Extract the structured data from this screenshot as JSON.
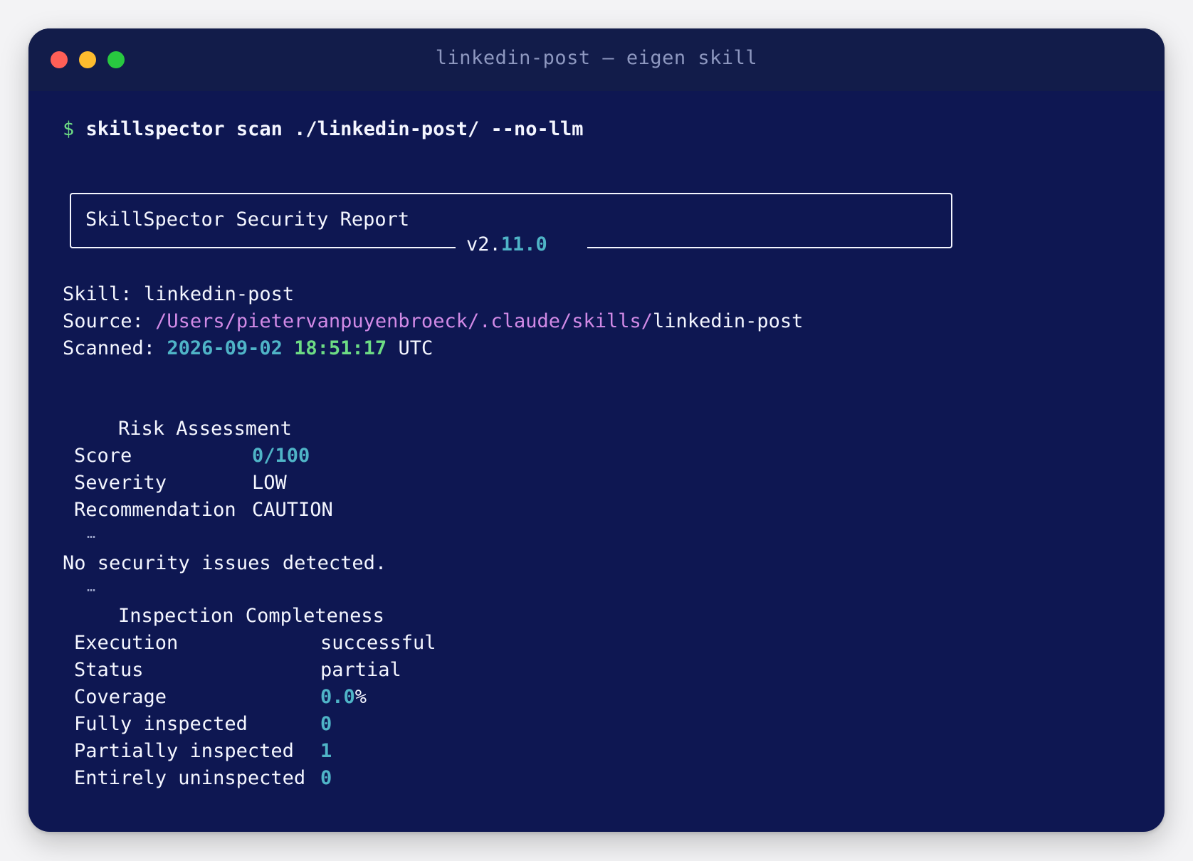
{
  "window": {
    "title": "linkedin-post — eigen skill"
  },
  "prompt": {
    "symbol": "$",
    "command": "skillspector scan ./linkedin-post/ --no-llm"
  },
  "report_box": {
    "title": "SkillSpector Security Report",
    "version_prefix": "v2.",
    "version_suffix": "11.0"
  },
  "meta": {
    "skill_label": "Skill:",
    "skill_value": "linkedin-post",
    "source_label": "Source:",
    "source_path_dim": "/Users/pietervanpuyenbroeck/.claude/skills/",
    "source_path_name": "linkedin-post",
    "scanned_label": "Scanned:",
    "scanned_date": "2026-09-02",
    "scanned_time": "18:51:17",
    "scanned_tz": "UTC"
  },
  "risk": {
    "heading": "Risk Assessment",
    "rows": [
      {
        "label": "Score",
        "value": "0/100"
      },
      {
        "label": "Severity",
        "value": "LOW"
      },
      {
        "label": "Recommendation",
        "value": "CAUTION"
      }
    ]
  },
  "separator": "…",
  "issues_message": "No security issues detected.",
  "completeness": {
    "heading": "Inspection Completeness",
    "rows": [
      {
        "label": "Execution",
        "value": "successful"
      },
      {
        "label": "Status",
        "value": "partial"
      },
      {
        "label": "Coverage",
        "value": "0.0",
        "unit": "%"
      },
      {
        "label": "Fully inspected",
        "value": "0"
      },
      {
        "label": "Partially inspected",
        "value": "1"
      },
      {
        "label": "Entirely uninspected",
        "value": "0"
      }
    ]
  },
  "colors": {
    "background": "#0e1752",
    "titlebar": "#121c4a",
    "prompt": "#6ddc84",
    "number": "#4fb4c7",
    "path": "#d18ae6",
    "text": "#f4f6ff"
  }
}
